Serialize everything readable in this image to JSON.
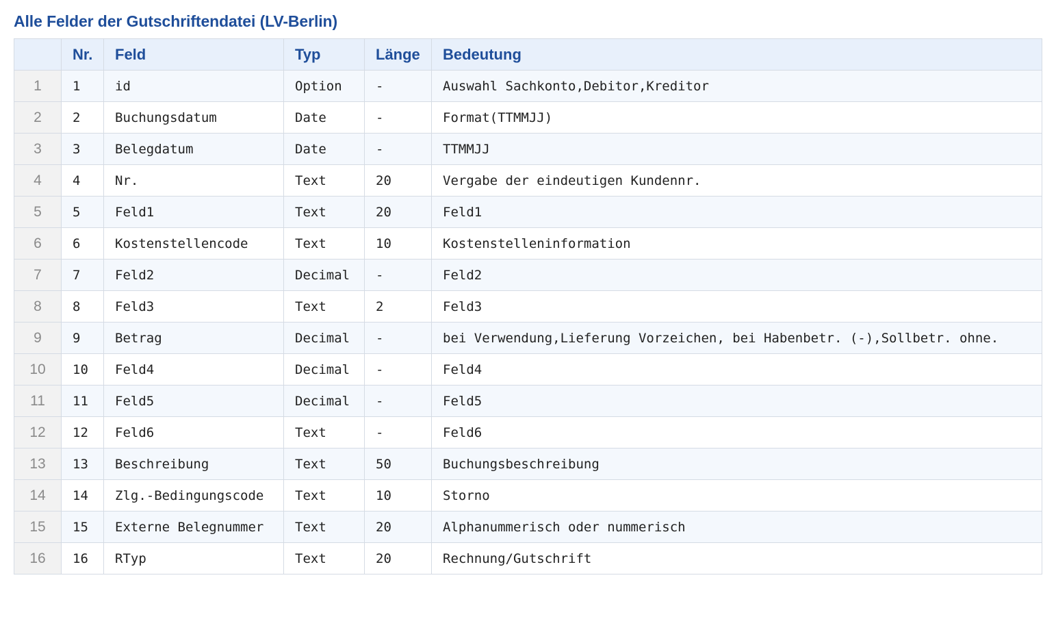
{
  "title": "Alle Felder der Gutschriftendatei (LV-Berlin)",
  "table": {
    "headers": {
      "rownum": "",
      "nr": "Nr.",
      "feld": "Feld",
      "typ": "Typ",
      "laenge": "Länge",
      "bedeutung": "Bedeutung"
    },
    "rows": [
      {
        "rownum": "1",
        "nr": "1",
        "feld": "id",
        "typ": "Option",
        "laenge": "-",
        "bedeutung": "Auswahl Sachkonto,Debitor,Kreditor"
      },
      {
        "rownum": "2",
        "nr": "2",
        "feld": "Buchungsdatum",
        "typ": "Date",
        "laenge": "-",
        "bedeutung": "Format(TTMMJJ)"
      },
      {
        "rownum": "3",
        "nr": "3",
        "feld": "Belegdatum",
        "typ": "Date",
        "laenge": "-",
        "bedeutung": "TTMMJJ"
      },
      {
        "rownum": "4",
        "nr": "4",
        "feld": "Nr.",
        "typ": "Text",
        "laenge": "20",
        "bedeutung": "Vergabe der eindeutigen Kundennr."
      },
      {
        "rownum": "5",
        "nr": "5",
        "feld": "Feld1",
        "typ": "Text",
        "laenge": "20",
        "bedeutung": "Feld1"
      },
      {
        "rownum": "6",
        "nr": "6",
        "feld": "Kostenstellencode",
        "typ": "Text",
        "laenge": "10",
        "bedeutung": "Kostenstelleninformation"
      },
      {
        "rownum": "7",
        "nr": "7",
        "feld": "Feld2",
        "typ": "Decimal",
        "laenge": "-",
        "bedeutung": "Feld2"
      },
      {
        "rownum": "8",
        "nr": "8",
        "feld": "Feld3",
        "typ": "Text",
        "laenge": "2",
        "bedeutung": "Feld3"
      },
      {
        "rownum": "9",
        "nr": "9",
        "feld": "Betrag",
        "typ": "Decimal",
        "laenge": "-",
        "bedeutung": "bei Verwendung,Lieferung Vorzeichen, bei Habenbetr. (-),Sollbetr. ohne."
      },
      {
        "rownum": "10",
        "nr": "10",
        "feld": "Feld4",
        "typ": "Decimal",
        "laenge": "-",
        "bedeutung": "Feld4"
      },
      {
        "rownum": "11",
        "nr": "11",
        "feld": "Feld5",
        "typ": "Decimal",
        "laenge": "-",
        "bedeutung": "Feld5"
      },
      {
        "rownum": "12",
        "nr": "12",
        "feld": "Feld6",
        "typ": "Text",
        "laenge": "-",
        "bedeutung": "Feld6"
      },
      {
        "rownum": "13",
        "nr": "13",
        "feld": "Beschreibung",
        "typ": "Text",
        "laenge": "50",
        "bedeutung": "Buchungsbeschreibung"
      },
      {
        "rownum": "14",
        "nr": "14",
        "feld": "Zlg.-Bedingungscode",
        "typ": "Text",
        "laenge": "10",
        "bedeutung": "Storno"
      },
      {
        "rownum": "15",
        "nr": "15",
        "feld": "Externe Belegnummer",
        "typ": "Text",
        "laenge": "20",
        "bedeutung": "Alphanummerisch oder nummerisch"
      },
      {
        "rownum": "16",
        "nr": "16",
        "feld": "RTyp",
        "typ": "Text",
        "laenge": "20",
        "bedeutung": "Rechnung/Gutschrift"
      }
    ]
  }
}
